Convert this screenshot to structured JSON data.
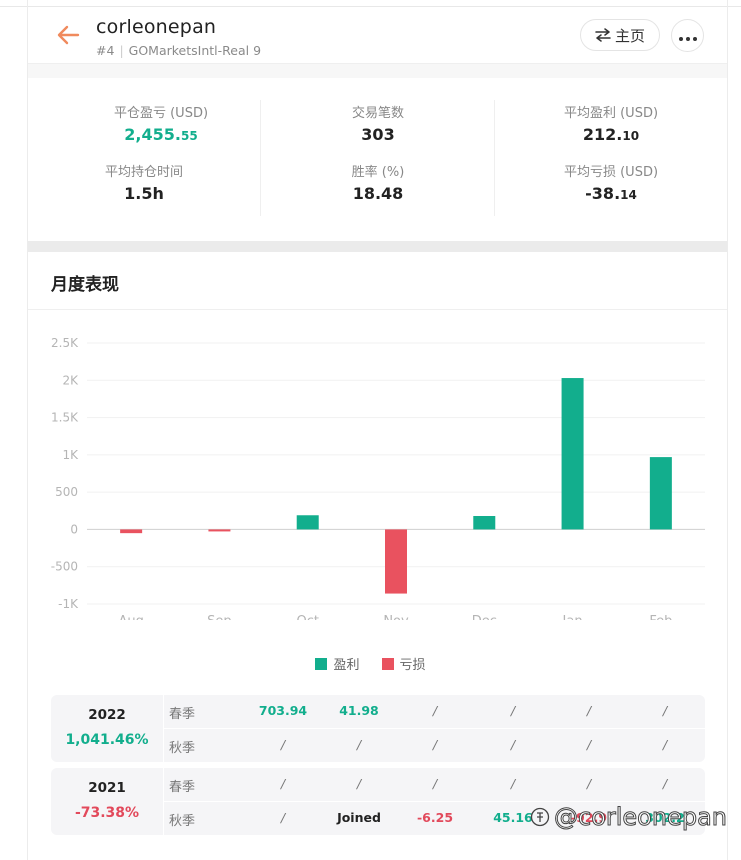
{
  "header": {
    "username": "corleonepan",
    "rank": "#4",
    "account": "GOMarketsIntl-Real 9",
    "home_label": "主页"
  },
  "stats": [
    {
      "label": "平仓盈亏 (USD)",
      "value_main": "2,455.",
      "value_small": "55",
      "color": "#12ae8d"
    },
    {
      "label": "交易笔数",
      "value_main": "303",
      "value_small": ""
    },
    {
      "label": "平均盈利 (USD)",
      "value_main": "212.",
      "value_small": "10"
    },
    {
      "label": "平均持仓时间",
      "value_main": "1.5h",
      "value_small": ""
    },
    {
      "label": "胜率 (%)",
      "value_main": "18.48",
      "value_small": ""
    },
    {
      "label": "平均亏损 (USD)",
      "value_main": "-38.",
      "value_small": "14"
    }
  ],
  "monthly": {
    "title": "月度表现"
  },
  "chart_data": {
    "type": "bar",
    "categories": [
      "Aug",
      "Sep",
      "Oct",
      "Nov",
      "Dec",
      "Jan",
      "Feb"
    ],
    "values": [
      -50,
      -25,
      190,
      -860,
      180,
      2030,
      970
    ],
    "yticks": [
      2500,
      2000,
      1500,
      1000,
      500,
      0,
      -500,
      -1000
    ],
    "ytick_labels": [
      "2.5K",
      "2K",
      "1.5K",
      "1K",
      "500",
      "0",
      "-500",
      "-1K"
    ],
    "ylim": [
      -1000,
      2500
    ],
    "legend": [
      "盈利",
      "亏损"
    ],
    "legend_position": "bottom-center",
    "colors": {
      "profit": "#12ae8d",
      "loss": "#e9525f"
    },
    "grid": true
  },
  "years": [
    {
      "year": "2022",
      "pct": "1,041.46%",
      "pct_color": "#12ae8d",
      "rows": [
        {
          "label": "春季",
          "cells": [
            "703.94",
            "41.98",
            "/",
            "/",
            "/",
            "/"
          ],
          "styles": [
            "g",
            "g",
            "slash",
            "slash",
            "slash",
            "slash"
          ]
        },
        {
          "label": "秋季",
          "cells": [
            "/",
            "/",
            "/",
            "/",
            "/",
            "/"
          ],
          "styles": [
            "slash",
            "slash",
            "slash",
            "slash",
            "slash",
            "slash"
          ]
        }
      ]
    },
    {
      "year": "2021",
      "pct": "-73.38%",
      "pct_color": "#e2495b",
      "rows": [
        {
          "label": "春季",
          "cells": [
            "/",
            "/",
            "/",
            "/",
            "/",
            "/"
          ],
          "styles": [
            "slash",
            "slash",
            "slash",
            "slash",
            "slash",
            "slash"
          ]
        },
        {
          "label": "秋季",
          "cells": [
            "/",
            "Joined",
            "-6.25",
            "45.16",
            "-92.9",
            "302.2"
          ],
          "styles": [
            "slash",
            "k",
            "r",
            "g",
            "r",
            "g"
          ]
        }
      ]
    }
  ],
  "watermark": "@corleonepan"
}
